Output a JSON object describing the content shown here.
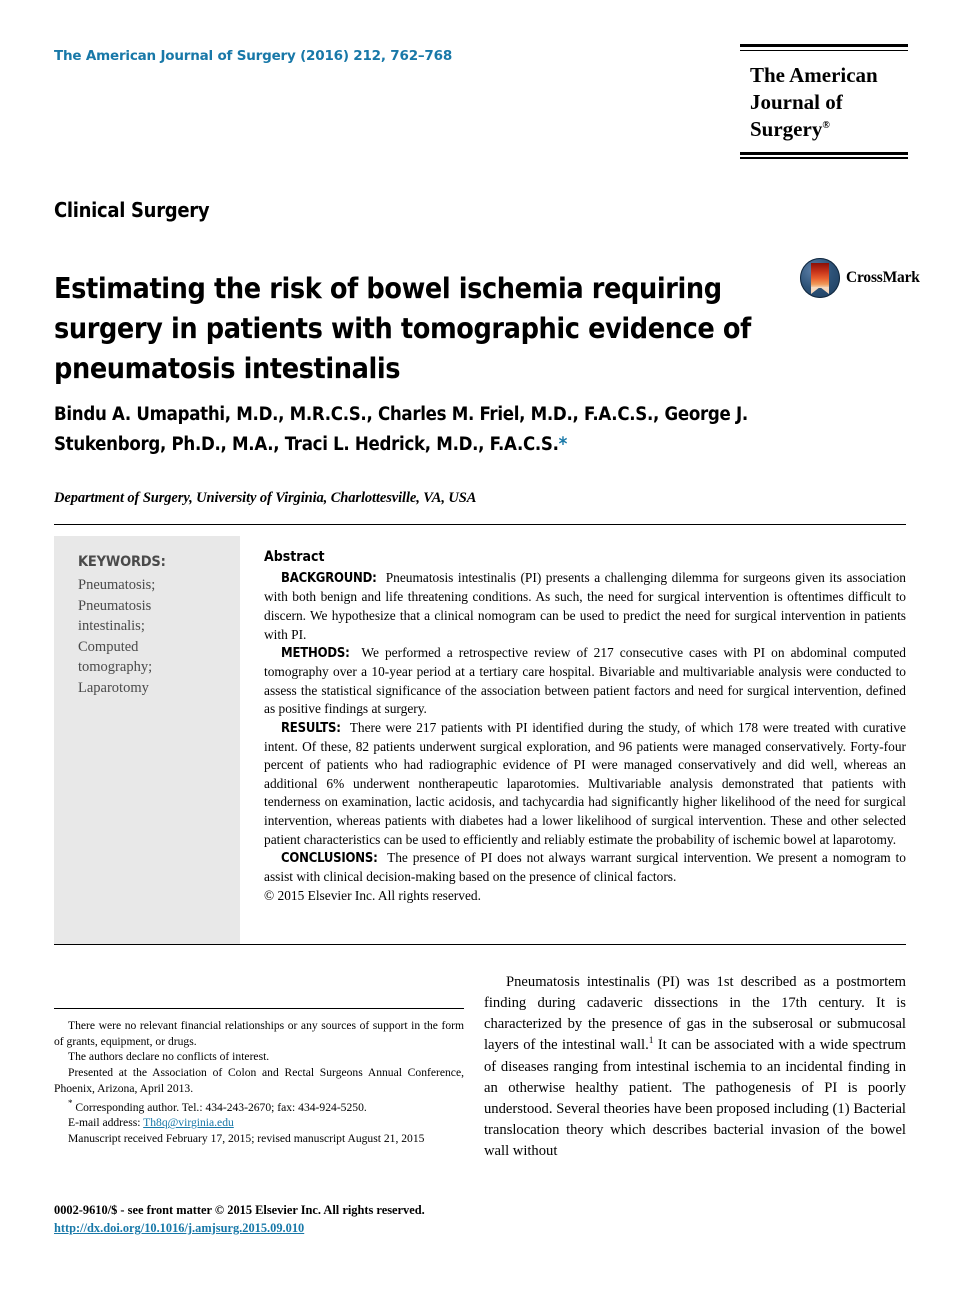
{
  "masthead": {
    "journal_reference": "The American Journal of Surgery (2016) 212, 762–768",
    "logo_line1": "The American",
    "logo_line2": "Journal of Surgery",
    "logo_superscript": "®"
  },
  "article": {
    "section_label": "Clinical Surgery",
    "title": "Estimating the risk of bowel ischemia requiring surgery in patients with tomographic evidence of pneumatosis intestinalis",
    "authors": "Bindu A. Umapathi, M.D., M.R.C.S., Charles M. Friel, M.D., F.A.C.S., George J. Stukenborg, Ph.D., M.A., Traci L. Hedrick, M.D., F.A.C.S.",
    "corresponding_marker": "*",
    "affiliation": "Department of Surgery, University of Virginia, Charlottesville, VA, USA"
  },
  "crossmark": {
    "label": "CrossMark"
  },
  "keywords": {
    "heading": "KEYWORDS:",
    "items": [
      "Pneumatosis;",
      "Pneumatosis",
      "intestinalis;",
      "Computed",
      "tomography;",
      "Laparotomy"
    ]
  },
  "abstract": {
    "heading": "Abstract",
    "background_label": "BACKGROUND:",
    "background_text": "Pneumatosis intestinalis (PI) presents a challenging dilemma for surgeons given its association with both benign and life threatening conditions. As such, the need for surgical intervention is oftentimes difficult to discern. We hypothesize that a clinical nomogram can be used to predict the need for surgical intervention in patients with PI.",
    "methods_label": "METHODS:",
    "methods_text": "We performed a retrospective review of 217 consecutive cases with PI on abdominal computed tomography over a 10-year period at a tertiary care hospital. Bivariable and multivariable analysis were conducted to assess the statistical significance of the association between patient factors and need for surgical intervention, defined as positive findings at surgery.",
    "results_label": "RESULTS:",
    "results_text": "There were 217 patients with PI identified during the study, of which 178 were treated with curative intent. Of these, 82 patients underwent surgical exploration, and 96 patients were managed conservatively. Forty-four percent of patients who had radiographic evidence of PI were managed conservatively and did well, whereas an additional 6% underwent nontherapeutic laparotomies. Multivariable analysis demonstrated that patients with tenderness on examination, lactic acidosis, and tachycardia had significantly higher likelihood of the need for surgical intervention, whereas patients with diabetes had a lower likelihood of surgical intervention. These and other selected patient characteristics can be used to efficiently and reliably estimate the probability of ischemic bowel at laparotomy.",
    "conclusions_label": "CONCLUSIONS:",
    "conclusions_text": "The presence of PI does not always warrant surgical intervention. We present a nomogram to assist with clinical decision-making based on the presence of clinical factors.",
    "copyright": "© 2015 Elsevier Inc. All rights reserved."
  },
  "footnotes": {
    "funding": "There were no relevant financial relationships or any sources of support in the form of grants, equipment, or drugs.",
    "conflicts": "The authors declare no conflicts of interest.",
    "presented": "Presented at the Association of Colon and Rectal Surgeons Annual Conference, Phoenix, Arizona, April 2013.",
    "corresponding": "Corresponding author. Tel.: 434-243-2670; fax: 434-924-5250.",
    "email_label": "E-mail address:",
    "email": "Th8q@virginia.edu",
    "manuscript_dates": "Manuscript received February 17, 2015; revised manuscript August 21, 2015"
  },
  "body": {
    "paragraph_1_a": "Pneumatosis intestinalis (PI) was 1st described as a postmortem finding during cadaveric dissections in the 17th century. It is characterized by the presence of gas in the subserosal or submucosal layers of the intestinal wall.",
    "paragraph_1_ref": "1",
    "paragraph_1_b": "It can be associated with a wide spectrum of diseases ranging from intestinal ischemia to an incidental finding in an otherwise healthy patient. The pathogenesis of PI is poorly understood. Several theories have been proposed including (1) Bacterial translocation theory which describes bacterial invasion of the bowel wall without"
  },
  "page_footer": {
    "issn_line": "0002-9610/$ - see front matter © 2015 Elsevier Inc. All rights reserved.",
    "doi": "http://dx.doi.org/10.1016/j.amjsurg.2015.09.010"
  },
  "colors": {
    "link_blue": "#1878a8",
    "keywords_bg": "#e8e8e8",
    "keywords_text": "#4a4a4a"
  }
}
